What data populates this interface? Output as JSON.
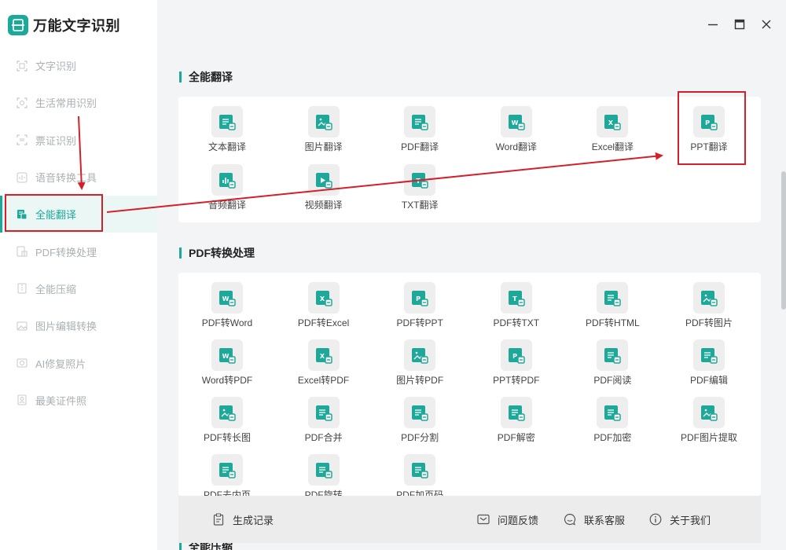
{
  "app": {
    "title": "万能文字识别"
  },
  "sidebar": {
    "items": [
      {
        "label": "文字识别",
        "icon": "scan-text-icon"
      },
      {
        "label": "生活常用识别",
        "icon": "scan-life-icon"
      },
      {
        "label": "票证识别",
        "icon": "scan-ticket-icon"
      },
      {
        "label": "语音转换工具",
        "icon": "audio-convert-icon"
      },
      {
        "label": "全能翻译",
        "icon": "translate-icon",
        "active": true
      },
      {
        "label": "PDF转换处理",
        "icon": "pdf-convert-icon"
      },
      {
        "label": "全能压缩",
        "icon": "compress-icon"
      },
      {
        "label": "图片编辑转换",
        "icon": "image-edit-icon"
      },
      {
        "label": "AI修复照片",
        "icon": "ai-photo-icon"
      },
      {
        "label": "最美证件照",
        "icon": "id-photo-icon"
      }
    ]
  },
  "sections": {
    "translate": {
      "title": "全能翻译",
      "tiles": [
        {
          "label": "文本翻译",
          "icon": "text-doc-icon"
        },
        {
          "label": "图片翻译",
          "icon": "image-doc-icon"
        },
        {
          "label": "PDF翻译",
          "icon": "pdf-doc-icon"
        },
        {
          "label": "Word翻译",
          "icon": "word-doc-icon"
        },
        {
          "label": "Excel翻译",
          "icon": "excel-doc-icon"
        },
        {
          "label": "PPT翻译",
          "icon": "ppt-doc-icon"
        },
        {
          "label": "音频翻译",
          "icon": "audio-doc-icon"
        },
        {
          "label": "视频翻译",
          "icon": "video-doc-icon"
        },
        {
          "label": "TXT翻译",
          "icon": "txt-doc-icon"
        }
      ]
    },
    "pdf": {
      "title": "PDF转换处理",
      "tiles": [
        {
          "label": "PDF转Word",
          "icon": "pdf-to-word-icon"
        },
        {
          "label": "PDF转Excel",
          "icon": "pdf-to-excel-icon"
        },
        {
          "label": "PDF转PPT",
          "icon": "pdf-to-ppt-icon"
        },
        {
          "label": "PDF转TXT",
          "icon": "pdf-to-txt-icon"
        },
        {
          "label": "PDF转HTML",
          "icon": "pdf-to-html-icon"
        },
        {
          "label": "PDF转图片",
          "icon": "pdf-to-image-icon"
        },
        {
          "label": "Word转PDF",
          "icon": "word-to-pdf-icon"
        },
        {
          "label": "Excel转PDF",
          "icon": "excel-to-pdf-icon"
        },
        {
          "label": "图片转PDF",
          "icon": "image-to-pdf-icon"
        },
        {
          "label": "PPT转PDF",
          "icon": "ppt-to-pdf-icon"
        },
        {
          "label": "PDF阅读",
          "icon": "pdf-read-icon"
        },
        {
          "label": "PDF编辑",
          "icon": "pdf-edit-icon"
        },
        {
          "label": "PDF转长图",
          "icon": "pdf-long-image-icon"
        },
        {
          "label": "PDF合并",
          "icon": "pdf-merge-icon"
        },
        {
          "label": "PDF分割",
          "icon": "pdf-split-icon"
        },
        {
          "label": "PDF解密",
          "icon": "pdf-decrypt-icon"
        },
        {
          "label": "PDF加密",
          "icon": "pdf-encrypt-icon"
        },
        {
          "label": "PDF图片提取",
          "icon": "pdf-extract-image-icon"
        },
        {
          "label": "PDF去内页",
          "icon": "pdf-remove-page-icon"
        },
        {
          "label": "PDF旋转",
          "icon": "pdf-rotate-icon"
        },
        {
          "label": "PDF加页码",
          "icon": "pdf-page-number-icon"
        }
      ]
    },
    "compress": {
      "title": "全能压缩"
    }
  },
  "footer": {
    "history": "生成记录",
    "feedback": "问题反馈",
    "service": "联系客服",
    "about": "关于我们"
  },
  "colors": {
    "accent": "#1ea89a",
    "annotation": "#d4202a"
  }
}
